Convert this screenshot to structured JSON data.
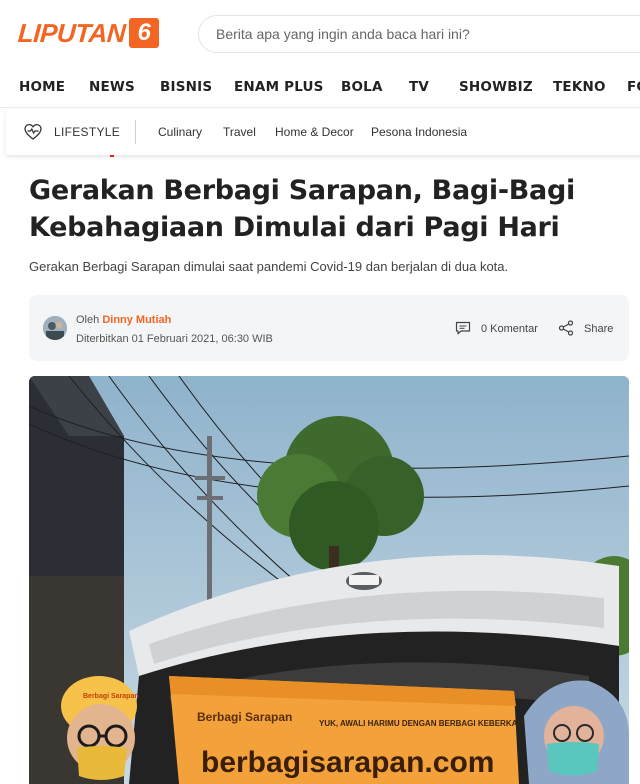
{
  "brand": {
    "logo_text": "LIPUTAN",
    "logo_number": "6",
    "accent_color": "#f26522",
    "link_color": "#f26522",
    "highlight_red": "#e2231a"
  },
  "search": {
    "placeholder": "Berita apa yang ingin anda baca hari ini?",
    "icon": "search-icon"
  },
  "main_nav": [
    {
      "label": "HOME"
    },
    {
      "label": "NEWS"
    },
    {
      "label": "BISNIS"
    },
    {
      "label": "ENAM PLUS"
    },
    {
      "label": "BOLA"
    },
    {
      "label": "TV"
    },
    {
      "label": "SHOWBIZ"
    },
    {
      "label": "TEKNO"
    },
    {
      "label": "FO"
    }
  ],
  "sub_nav": {
    "section_icon": "heart-pulse-icon",
    "section_label": "LIFESTYLE",
    "items": [
      {
        "label": "Culinary"
      },
      {
        "label": "Travel"
      },
      {
        "label": "Home & Decor"
      },
      {
        "label": "Pesona Indonesia"
      }
    ]
  },
  "article": {
    "title": "Gerakan Berbagi Sarapan, Bagi-Bagi Kebahagiaan Dimulai dari Pagi Hari",
    "lede": "Gerakan Berbagi Sarapan dimulai saat pandemi Covid-19 dan berjalan di dua kota.",
    "byline_prefix": "Oleh",
    "author": "Dinny Mutiah",
    "published": "Diterbitkan 01 Februari 2021, 06:30 WIB",
    "comments_label": "0 Komentar",
    "comments_icon": "comment-icon",
    "share_label": "Share",
    "share_icon": "share-icon"
  },
  "photo": {
    "banner_brand": "Berbagi Sarapan",
    "banner_slogan": "YUK, AWALI HARIMU DENGAN BERBAGI KEBERKAHAN !",
    "banner_url": "berbagisarapan.com",
    "cap_logo": "Berbagi Sarapan"
  }
}
